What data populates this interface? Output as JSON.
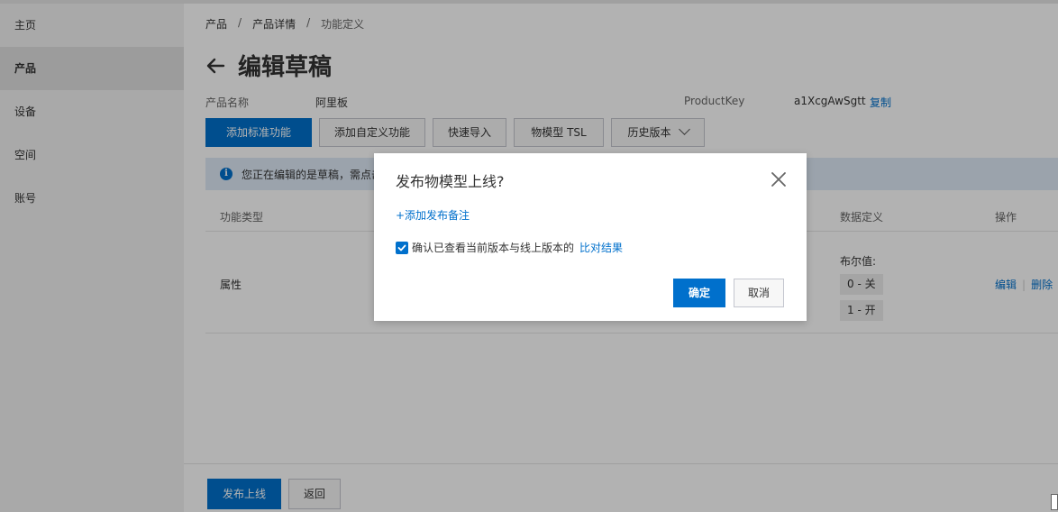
{
  "sidebar": {
    "items": [
      {
        "label": "主页"
      },
      {
        "label": "产品"
      },
      {
        "label": "设备"
      },
      {
        "label": "空间"
      },
      {
        "label": "账号"
      }
    ]
  },
  "breadcrumb": {
    "items": [
      "产品",
      "产品详情",
      "功能定义"
    ],
    "separator": "/"
  },
  "page": {
    "title": "编辑草稿",
    "product_name_label": "产品名称",
    "product_name_value": "阿里板",
    "product_key_label": "ProductKey",
    "product_key_value": "a1XcgAwSgtt",
    "copy_label": "复制"
  },
  "toolbar": {
    "add_standard": "添加标准功能",
    "add_custom": "添加自定义功能",
    "quick_import": "快速导入",
    "tsl": "物模型 TSL",
    "history": "历史版本"
  },
  "notice": {
    "text": "您正在编辑的是草稿，需点击"
  },
  "table": {
    "headers": {
      "type": "功能类型",
      "data_def": "数据定义",
      "ops": "操作"
    },
    "row": {
      "type": "属性",
      "data_def_title": "布尔值:",
      "tags": [
        "0 - 关",
        "1 - 开"
      ],
      "edit": "编辑",
      "delete": "删除"
    }
  },
  "footer": {
    "publish": "发布上线",
    "back": "返回"
  },
  "dialog": {
    "title": "发布物模型上线?",
    "add_note": "+添加发布备注",
    "confirm_text": "确认已查看当前版本与线上版本的",
    "compare_link": "比对结果",
    "ok": "确定",
    "cancel": "取消",
    "checkbox_checked": true
  },
  "colors": {
    "primary": "#0070cc",
    "notice_bg": "#dfeaf6"
  }
}
